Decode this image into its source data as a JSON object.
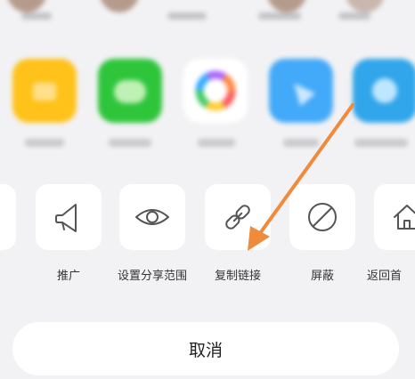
{
  "share_options": [
    {
      "label": "推广",
      "icon": "megaphone-icon"
    },
    {
      "label": "设置分享范围",
      "icon": "eye-icon"
    },
    {
      "label": "复制链接",
      "icon": "link-icon"
    },
    {
      "label": "屏蔽",
      "icon": "block-icon"
    },
    {
      "label": "返回首",
      "icon": "home-icon"
    }
  ],
  "cancel_label": "取消",
  "colors": {
    "background": "#f2f2f4",
    "tile": "#ffffff",
    "icon_stroke": "#555555",
    "arrow": "#f08a3c",
    "app_yellow": "#ffc21a",
    "app_green": "#2fc53b",
    "app_blue": "#42aaf8"
  }
}
